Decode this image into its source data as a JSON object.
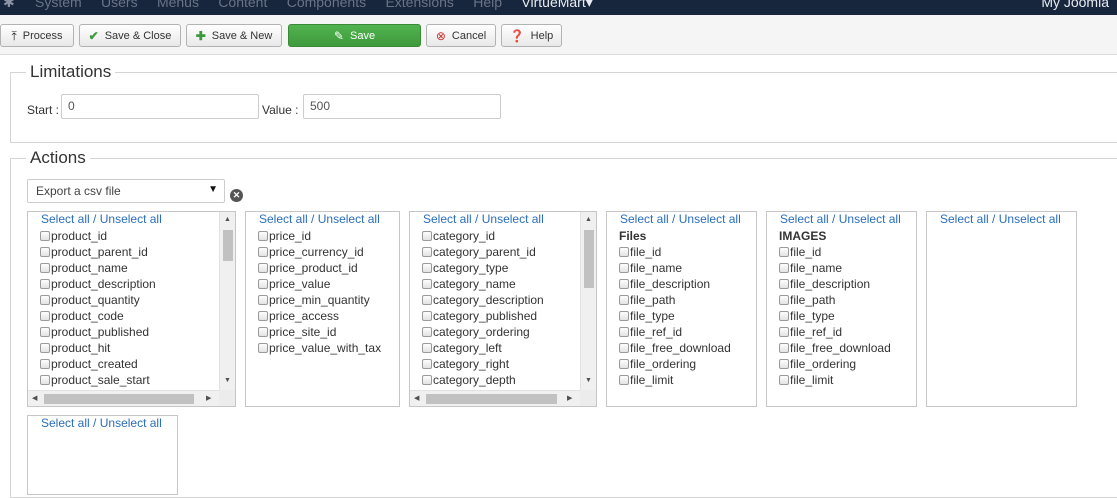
{
  "navbar": {
    "menu": [
      "System",
      "Users",
      "Menus",
      "Content",
      "Components",
      "Extensions",
      "Help",
      "VirtueMart▾"
    ],
    "site": "My Joomla"
  },
  "toolbar": {
    "process": "Process",
    "save_close": "Save & Close",
    "save_new": "Save & New",
    "save": "Save",
    "cancel": "Cancel",
    "help": "Help"
  },
  "limitations": {
    "legend": "Limitations",
    "start_label": "Start :",
    "start_value": "0",
    "value_label": "Value :",
    "value_value": "500"
  },
  "actions": {
    "legend": "Actions",
    "export_select": "Export a csv file"
  },
  "select_all": "Select all",
  "separator": "/",
  "unselect_all": "Unselect all",
  "boxes": {
    "product": [
      "product_id",
      "product_parent_id",
      "product_name",
      "product_description",
      "product_quantity",
      "product_code",
      "product_published",
      "product_hit",
      "product_created",
      "product_sale_start"
    ],
    "price": [
      "price_id",
      "price_currency_id",
      "price_product_id",
      "price_value",
      "price_min_quantity",
      "price_access",
      "price_site_id",
      "price_value_with_tax"
    ],
    "category": [
      "category_id",
      "category_parent_id",
      "category_type",
      "category_name",
      "category_description",
      "category_published",
      "category_ordering",
      "category_left",
      "category_right",
      "category_depth"
    ],
    "files_title": "Files",
    "files": [
      "file_id",
      "file_name",
      "file_description",
      "file_path",
      "file_type",
      "file_ref_id",
      "file_free_download",
      "file_ordering",
      "file_limit"
    ],
    "images_title": "IMAGES",
    "images": [
      "file_id",
      "file_name",
      "file_description",
      "file_path",
      "file_type",
      "file_ref_id",
      "file_free_download",
      "file_ordering",
      "file_limit"
    ]
  }
}
